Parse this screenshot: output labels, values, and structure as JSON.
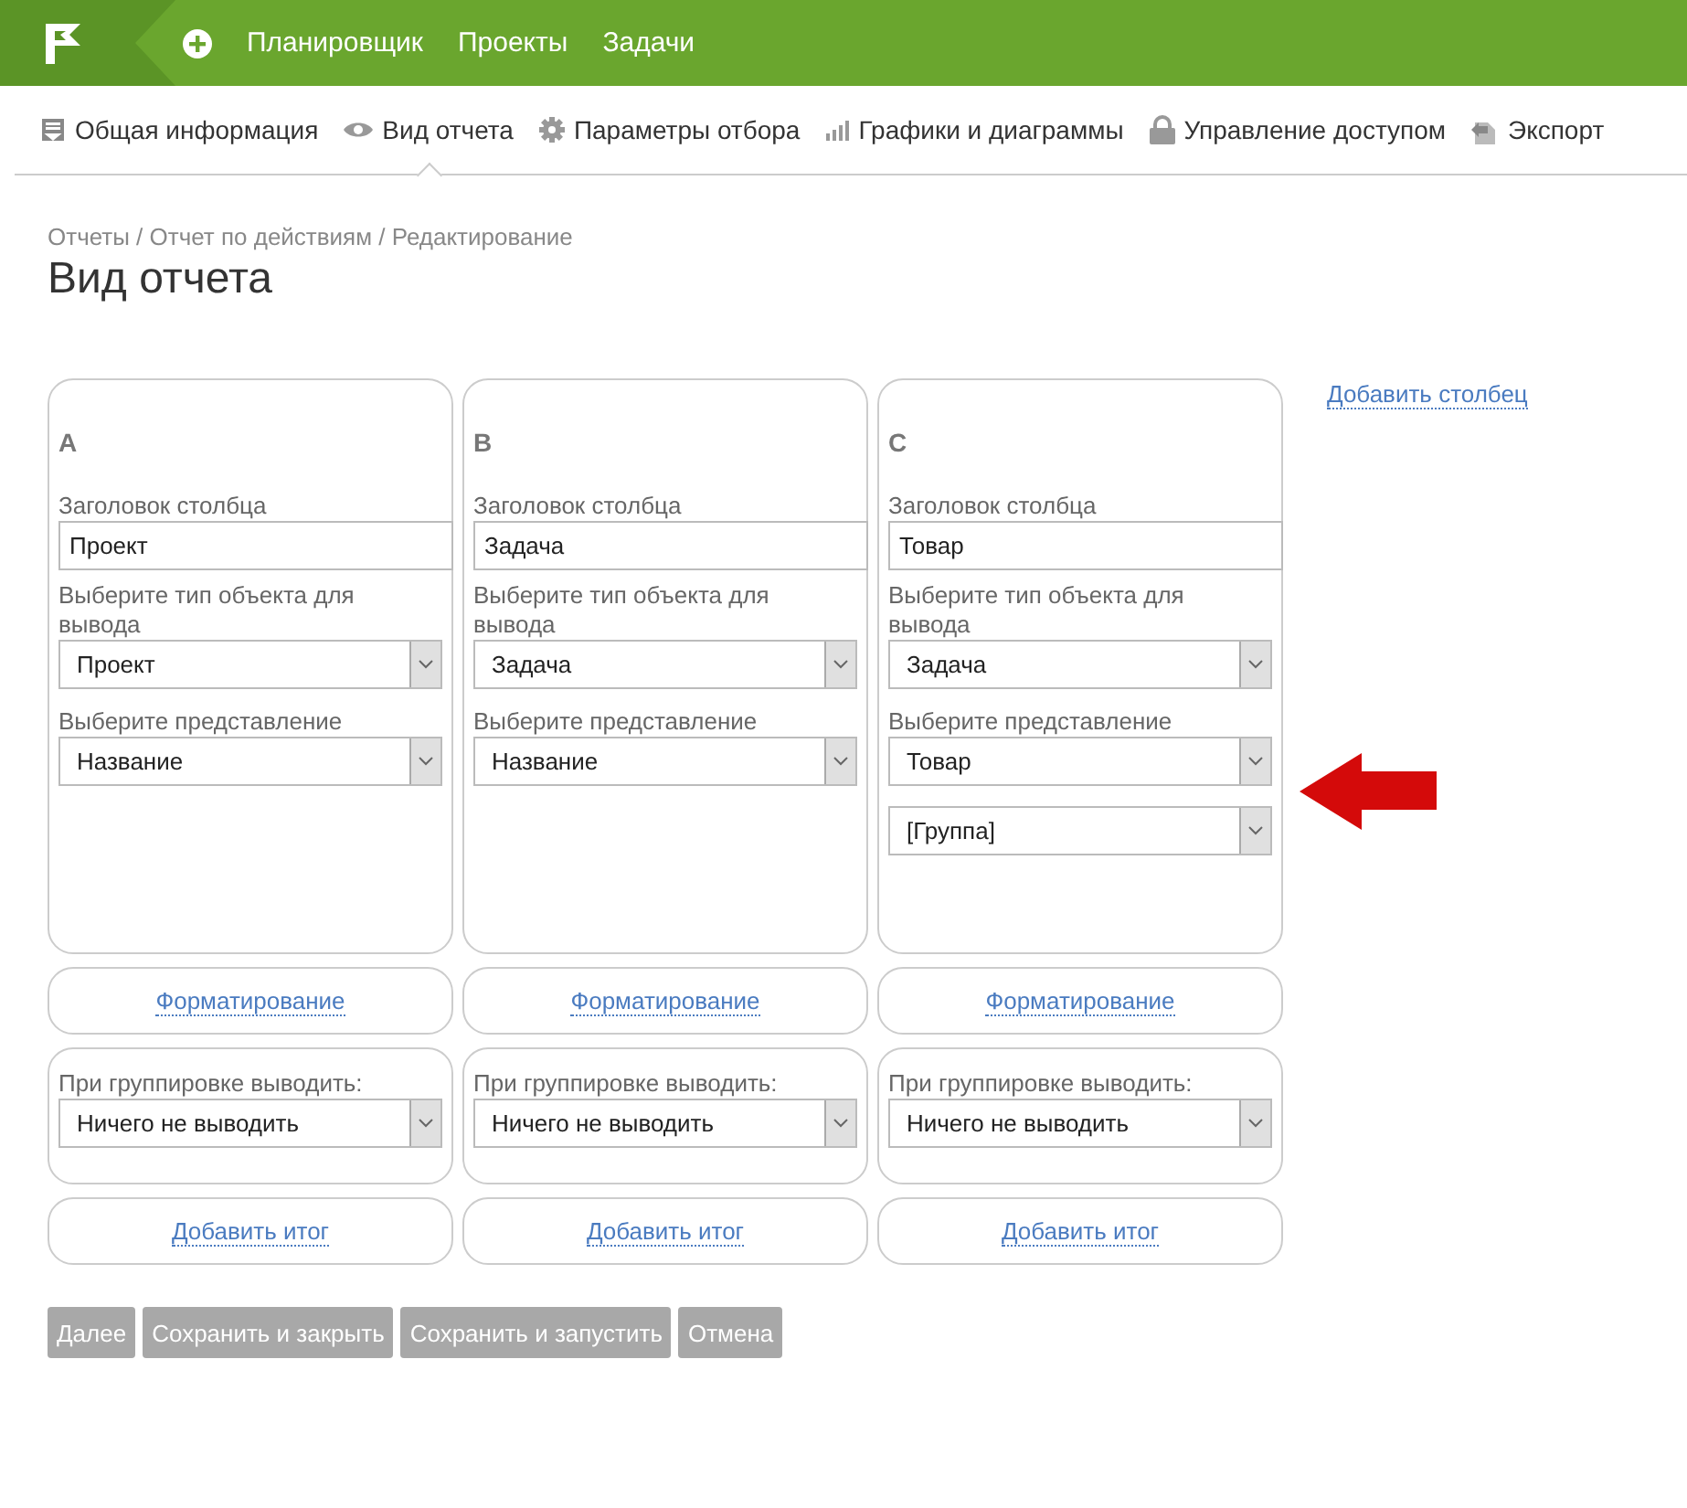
{
  "header": {
    "nav_items": [
      "Планировщик",
      "Проекты",
      "Задачи"
    ]
  },
  "tabs": [
    {
      "label": "Общая информация",
      "selected": false
    },
    {
      "label": "Вид отчета",
      "selected": true
    },
    {
      "label": "Параметры отбора",
      "selected": false
    },
    {
      "label": "Графики и диаграммы",
      "selected": false
    },
    {
      "label": "Управление доступом",
      "selected": false
    },
    {
      "label": "Экспорт",
      "selected": false
    }
  ],
  "breadcrumb": "Отчеты / Отчет по действиям / Редактирование",
  "title": "Вид отчета",
  "columns": [
    {
      "letter": "A",
      "title_label": "Заголовок столбца",
      "title_value": "Проект",
      "type_label": "Выберите тип объекта для вывода",
      "type_value": "Проект",
      "view_label": "Выберите представление",
      "view_value": "Название",
      "format_link": "Форматирование",
      "group_label": "При группировке выводить:",
      "group_value": "Ничего не выводить",
      "total_link": "Добавить итог"
    },
    {
      "letter": "B",
      "title_label": "Заголовок столбца",
      "title_value": "Задача",
      "type_label": "Выберите тип объекта для вывода",
      "type_value": "Задача",
      "view_label": "Выберите представление",
      "view_value": "Название",
      "format_link": "Форматирование",
      "group_label": "При группировке выводить:",
      "group_value": "Ничего не выводить",
      "total_link": "Добавить итог"
    },
    {
      "letter": "C",
      "title_label": "Заголовок столбца",
      "title_value": "Товар",
      "type_label": "Выберите тип объекта для вывода",
      "type_value": "Задача",
      "view_label": "Выберите представление",
      "view_value": "Товар",
      "extra_selects": [
        "[Группа]"
      ],
      "format_link": "Форматирование",
      "group_label": "При группировке выводить:",
      "group_value": "Ничего не выводить",
      "total_link": "Добавить итог"
    }
  ],
  "add_column_link": "Добавить столбец",
  "buttons": [
    "Далее",
    "Сохранить и закрыть",
    "Сохранить и запустить",
    "Отмена"
  ]
}
